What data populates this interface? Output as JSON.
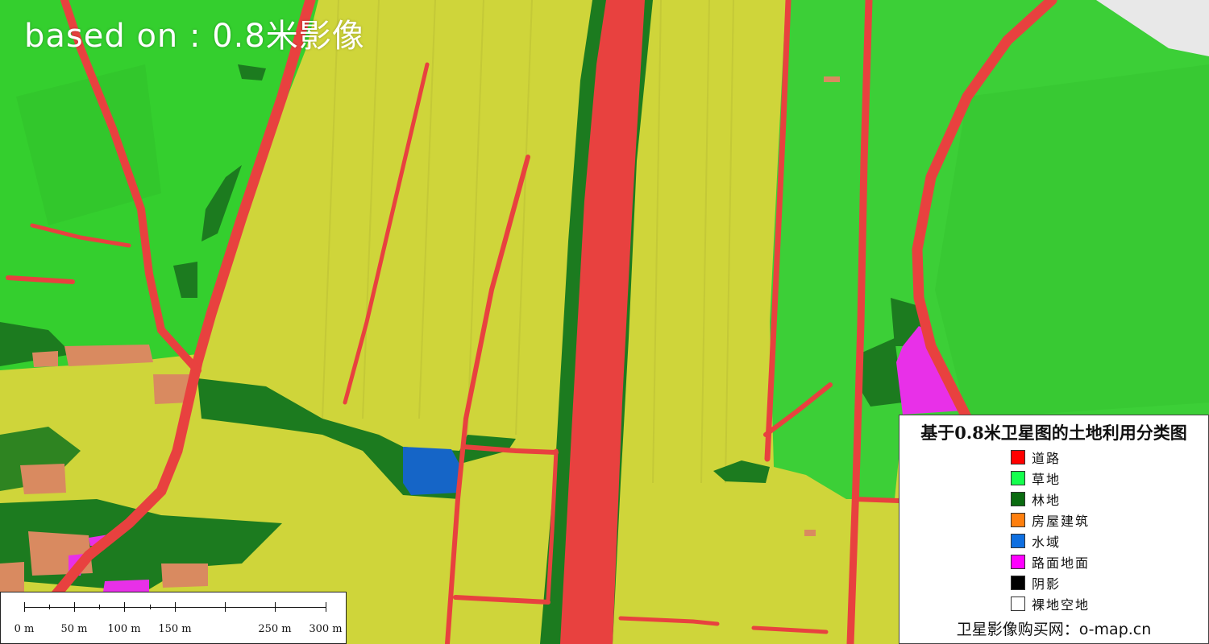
{
  "overlay_title": "based on : 0.8米影像",
  "colors": {
    "road": "#e8413f",
    "grass": "#33d42c",
    "forest": "#1c7b1f",
    "building": "#ff7d2a",
    "water": "#1565c7",
    "pavement": "#e830e8",
    "shadow": "#000000",
    "bare_land": "#ffffff",
    "farmland": "#cfd53a"
  },
  "legend": {
    "title": "基于0.8米卫星图的土地利用分类图",
    "items": [
      {
        "label": "道路",
        "color": "#ff0000"
      },
      {
        "label": "草地",
        "color": "#14ff4d"
      },
      {
        "label": "林地",
        "color": "#0a6b10"
      },
      {
        "label": "房屋建筑",
        "color": "#ff7f0e"
      },
      {
        "label": "水域",
        "color": "#0f6fe0"
      },
      {
        "label": "路面地面",
        "color": "#ff00ff"
      },
      {
        "label": "阴影",
        "color": "#000000"
      },
      {
        "label": "裸地空地",
        "color": "#ffffff"
      }
    ],
    "footer": "卫星影像购买网：o-map.cn"
  },
  "scale_bar": {
    "labels": [
      "0 m",
      "50 m",
      "100 m",
      "150 m",
      "250 m",
      "300 m"
    ]
  }
}
